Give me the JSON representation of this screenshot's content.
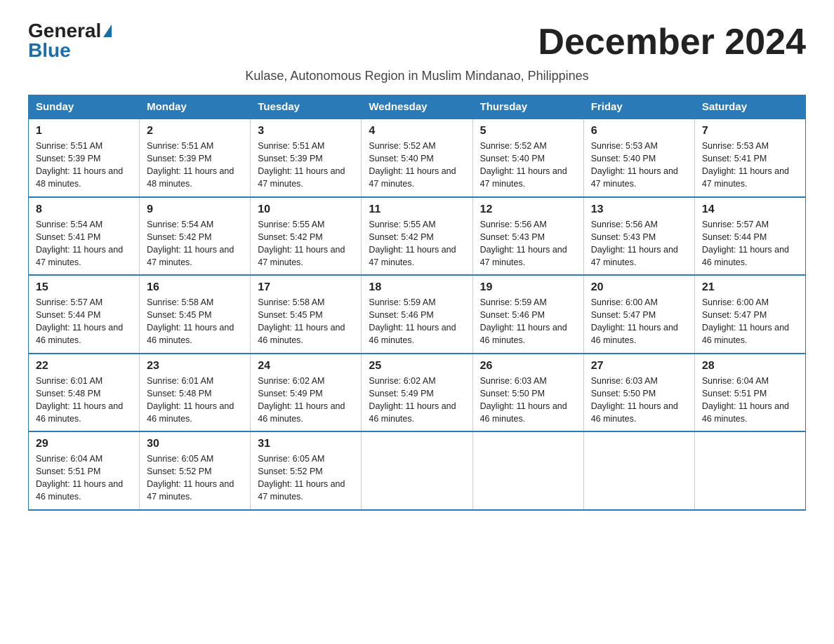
{
  "logo": {
    "general": "General",
    "blue": "Blue"
  },
  "title": "December 2024",
  "subtitle": "Kulase, Autonomous Region in Muslim Mindanao, Philippines",
  "days_of_week": [
    "Sunday",
    "Monday",
    "Tuesday",
    "Wednesday",
    "Thursday",
    "Friday",
    "Saturday"
  ],
  "weeks": [
    [
      {
        "day": "1",
        "sunrise": "5:51 AM",
        "sunset": "5:39 PM",
        "daylight": "11 hours and 48 minutes."
      },
      {
        "day": "2",
        "sunrise": "5:51 AM",
        "sunset": "5:39 PM",
        "daylight": "11 hours and 48 minutes."
      },
      {
        "day": "3",
        "sunrise": "5:51 AM",
        "sunset": "5:39 PM",
        "daylight": "11 hours and 47 minutes."
      },
      {
        "day": "4",
        "sunrise": "5:52 AM",
        "sunset": "5:40 PM",
        "daylight": "11 hours and 47 minutes."
      },
      {
        "day": "5",
        "sunrise": "5:52 AM",
        "sunset": "5:40 PM",
        "daylight": "11 hours and 47 minutes."
      },
      {
        "day": "6",
        "sunrise": "5:53 AM",
        "sunset": "5:40 PM",
        "daylight": "11 hours and 47 minutes."
      },
      {
        "day": "7",
        "sunrise": "5:53 AM",
        "sunset": "5:41 PM",
        "daylight": "11 hours and 47 minutes."
      }
    ],
    [
      {
        "day": "8",
        "sunrise": "5:54 AM",
        "sunset": "5:41 PM",
        "daylight": "11 hours and 47 minutes."
      },
      {
        "day": "9",
        "sunrise": "5:54 AM",
        "sunset": "5:42 PM",
        "daylight": "11 hours and 47 minutes."
      },
      {
        "day": "10",
        "sunrise": "5:55 AM",
        "sunset": "5:42 PM",
        "daylight": "11 hours and 47 minutes."
      },
      {
        "day": "11",
        "sunrise": "5:55 AM",
        "sunset": "5:42 PM",
        "daylight": "11 hours and 47 minutes."
      },
      {
        "day": "12",
        "sunrise": "5:56 AM",
        "sunset": "5:43 PM",
        "daylight": "11 hours and 47 minutes."
      },
      {
        "day": "13",
        "sunrise": "5:56 AM",
        "sunset": "5:43 PM",
        "daylight": "11 hours and 47 minutes."
      },
      {
        "day": "14",
        "sunrise": "5:57 AM",
        "sunset": "5:44 PM",
        "daylight": "11 hours and 46 minutes."
      }
    ],
    [
      {
        "day": "15",
        "sunrise": "5:57 AM",
        "sunset": "5:44 PM",
        "daylight": "11 hours and 46 minutes."
      },
      {
        "day": "16",
        "sunrise": "5:58 AM",
        "sunset": "5:45 PM",
        "daylight": "11 hours and 46 minutes."
      },
      {
        "day": "17",
        "sunrise": "5:58 AM",
        "sunset": "5:45 PM",
        "daylight": "11 hours and 46 minutes."
      },
      {
        "day": "18",
        "sunrise": "5:59 AM",
        "sunset": "5:46 PM",
        "daylight": "11 hours and 46 minutes."
      },
      {
        "day": "19",
        "sunrise": "5:59 AM",
        "sunset": "5:46 PM",
        "daylight": "11 hours and 46 minutes."
      },
      {
        "day": "20",
        "sunrise": "6:00 AM",
        "sunset": "5:47 PM",
        "daylight": "11 hours and 46 minutes."
      },
      {
        "day": "21",
        "sunrise": "6:00 AM",
        "sunset": "5:47 PM",
        "daylight": "11 hours and 46 minutes."
      }
    ],
    [
      {
        "day": "22",
        "sunrise": "6:01 AM",
        "sunset": "5:48 PM",
        "daylight": "11 hours and 46 minutes."
      },
      {
        "day": "23",
        "sunrise": "6:01 AM",
        "sunset": "5:48 PM",
        "daylight": "11 hours and 46 minutes."
      },
      {
        "day": "24",
        "sunrise": "6:02 AM",
        "sunset": "5:49 PM",
        "daylight": "11 hours and 46 minutes."
      },
      {
        "day": "25",
        "sunrise": "6:02 AM",
        "sunset": "5:49 PM",
        "daylight": "11 hours and 46 minutes."
      },
      {
        "day": "26",
        "sunrise": "6:03 AM",
        "sunset": "5:50 PM",
        "daylight": "11 hours and 46 minutes."
      },
      {
        "day": "27",
        "sunrise": "6:03 AM",
        "sunset": "5:50 PM",
        "daylight": "11 hours and 46 minutes."
      },
      {
        "day": "28",
        "sunrise": "6:04 AM",
        "sunset": "5:51 PM",
        "daylight": "11 hours and 46 minutes."
      }
    ],
    [
      {
        "day": "29",
        "sunrise": "6:04 AM",
        "sunset": "5:51 PM",
        "daylight": "11 hours and 46 minutes."
      },
      {
        "day": "30",
        "sunrise": "6:05 AM",
        "sunset": "5:52 PM",
        "daylight": "11 hours and 47 minutes."
      },
      {
        "day": "31",
        "sunrise": "6:05 AM",
        "sunset": "5:52 PM",
        "daylight": "11 hours and 47 minutes."
      },
      null,
      null,
      null,
      null
    ]
  ]
}
